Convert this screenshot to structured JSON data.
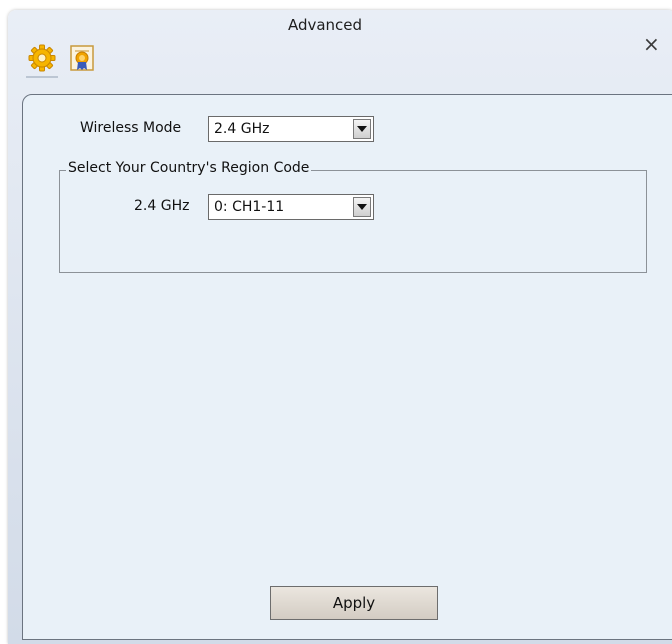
{
  "window": {
    "title": "Advanced",
    "close_glyph": "×"
  },
  "tabs": [
    {
      "name": "settings",
      "icon": "gear-icon",
      "selected": true
    },
    {
      "name": "about",
      "icon": "certificate-icon",
      "selected": false
    }
  ],
  "wireless_mode": {
    "label": "Wireless Mode",
    "value": "2.4 GHz"
  },
  "region_group": {
    "legend": "Select Your Country's Region Code",
    "band_label": "2.4 GHz",
    "band_value": "0: CH1-11"
  },
  "apply_label": "Apply",
  "colors": {
    "panel_bg": "#e9f1f8",
    "window_bg": "#dbe3ee",
    "button_bg": "#ddd6cd",
    "gear": "#f6b500",
    "cert_ribbon": "#3a5bb8"
  }
}
